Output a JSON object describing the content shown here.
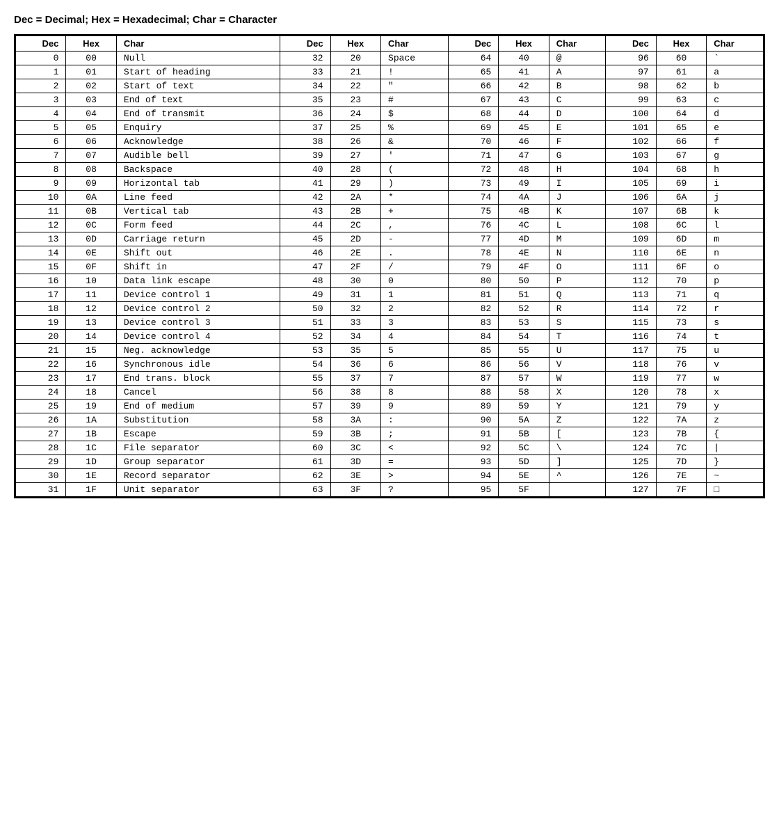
{
  "title": "Dec = Decimal; Hex = Hexadecimal; Char = Character",
  "headers": [
    "Dec",
    "Hex",
    "Char"
  ],
  "rows": [
    [
      0,
      "00",
      "Null",
      32,
      "20",
      "Space",
      64,
      "40",
      "@",
      96,
      "60",
      "`"
    ],
    [
      1,
      "01",
      "Start of heading",
      33,
      "21",
      "!",
      65,
      "41",
      "A",
      97,
      "61",
      "a"
    ],
    [
      2,
      "02",
      "Start of text",
      34,
      "22",
      "\"",
      66,
      "42",
      "B",
      98,
      "62",
      "b"
    ],
    [
      3,
      "03",
      "End of text",
      35,
      "23",
      "#",
      67,
      "43",
      "C",
      99,
      "63",
      "c"
    ],
    [
      4,
      "04",
      "End of transmit",
      36,
      "24",
      "$",
      68,
      "44",
      "D",
      100,
      "64",
      "d"
    ],
    [
      5,
      "05",
      "Enquiry",
      37,
      "25",
      "%",
      69,
      "45",
      "E",
      101,
      "65",
      "e"
    ],
    [
      6,
      "06",
      "Acknowledge",
      38,
      "26",
      "&",
      70,
      "46",
      "F",
      102,
      "66",
      "f"
    ],
    [
      7,
      "07",
      "Audible bell",
      39,
      "27",
      "'",
      71,
      "47",
      "G",
      103,
      "67",
      "g"
    ],
    [
      8,
      "08",
      "Backspace",
      40,
      "28",
      "(",
      72,
      "48",
      "H",
      104,
      "68",
      "h"
    ],
    [
      9,
      "09",
      "Horizontal tab",
      41,
      "29",
      ")",
      73,
      "49",
      "I",
      105,
      "69",
      "i"
    ],
    [
      10,
      "0A",
      "Line feed",
      42,
      "2A",
      "*",
      74,
      "4A",
      "J",
      106,
      "6A",
      "j"
    ],
    [
      11,
      "0B",
      "Vertical tab",
      43,
      "2B",
      "+",
      75,
      "4B",
      "K",
      107,
      "6B",
      "k"
    ],
    [
      12,
      "0C",
      "Form feed",
      44,
      "2C",
      ",",
      76,
      "4C",
      "L",
      108,
      "6C",
      "l"
    ],
    [
      13,
      "0D",
      "Carriage return",
      45,
      "2D",
      "-",
      77,
      "4D",
      "M",
      109,
      "6D",
      "m"
    ],
    [
      14,
      "0E",
      "Shift out",
      46,
      "2E",
      ".",
      78,
      "4E",
      "N",
      110,
      "6E",
      "n"
    ],
    [
      15,
      "0F",
      "Shift in",
      47,
      "2F",
      "/",
      79,
      "4F",
      "O",
      111,
      "6F",
      "o"
    ],
    [
      16,
      "10",
      "Data link escape",
      48,
      "30",
      "0",
      80,
      "50",
      "P",
      112,
      "70",
      "p"
    ],
    [
      17,
      "11",
      "Device control 1",
      49,
      "31",
      "1",
      81,
      "51",
      "Q",
      113,
      "71",
      "q"
    ],
    [
      18,
      "12",
      "Device control 2",
      50,
      "32",
      "2",
      82,
      "52",
      "R",
      114,
      "72",
      "r"
    ],
    [
      19,
      "13",
      "Device control 3",
      51,
      "33",
      "3",
      83,
      "53",
      "S",
      115,
      "73",
      "s"
    ],
    [
      20,
      "14",
      "Device control 4",
      52,
      "34",
      "4",
      84,
      "54",
      "T",
      116,
      "74",
      "t"
    ],
    [
      21,
      "15",
      "Neg. acknowledge",
      53,
      "35",
      "5",
      85,
      "55",
      "U",
      117,
      "75",
      "u"
    ],
    [
      22,
      "16",
      "Synchronous idle",
      54,
      "36",
      "6",
      86,
      "56",
      "V",
      118,
      "76",
      "v"
    ],
    [
      23,
      "17",
      "End trans. block",
      55,
      "37",
      "7",
      87,
      "57",
      "W",
      119,
      "77",
      "w"
    ],
    [
      24,
      "18",
      "Cancel",
      56,
      "38",
      "8",
      88,
      "58",
      "X",
      120,
      "78",
      "x"
    ],
    [
      25,
      "19",
      "End of medium",
      57,
      "39",
      "9",
      89,
      "59",
      "Y",
      121,
      "79",
      "y"
    ],
    [
      26,
      "1A",
      "Substitution",
      58,
      "3A",
      ":",
      90,
      "5A",
      "Z",
      122,
      "7A",
      "z"
    ],
    [
      27,
      "1B",
      "Escape",
      59,
      "3B",
      ";",
      91,
      "5B",
      "[",
      123,
      "7B",
      "{"
    ],
    [
      28,
      "1C",
      "File separator",
      60,
      "3C",
      "<",
      92,
      "5C",
      "\\",
      124,
      "7C",
      "|"
    ],
    [
      29,
      "1D",
      "Group separator",
      61,
      "3D",
      "=",
      93,
      "5D",
      "]",
      125,
      "7D",
      "}"
    ],
    [
      30,
      "1E",
      "Record separator",
      62,
      "3E",
      ">",
      94,
      "5E",
      "^",
      126,
      "7E",
      "~"
    ],
    [
      31,
      "1F",
      "Unit separator",
      63,
      "3F",
      "?",
      95,
      "5F",
      "",
      127,
      "7F",
      "□"
    ]
  ]
}
